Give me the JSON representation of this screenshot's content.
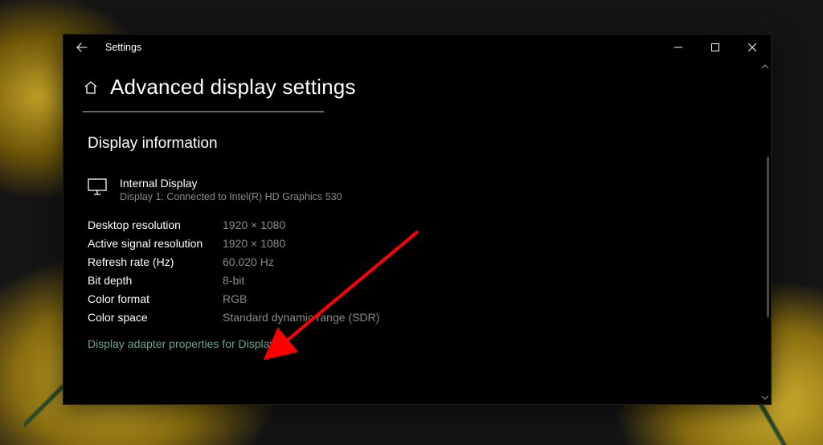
{
  "window": {
    "app_title": "Settings",
    "page_title": "Advanced display settings"
  },
  "section": {
    "heading": "Display information",
    "display_name": "Internal Display",
    "display_sub": "Display 1: Connected to Intel(R) HD Graphics 530",
    "props": {
      "desktop_res": {
        "label": "Desktop resolution",
        "value": "1920 × 1080"
      },
      "signal_res": {
        "label": "Active signal resolution",
        "value": "1920 × 1080"
      },
      "refresh": {
        "label": "Refresh rate (Hz)",
        "value": "60.020 Hz"
      },
      "bit_depth": {
        "label": "Bit depth",
        "value": "8-bit"
      },
      "color_format": {
        "label": "Color format",
        "value": "RGB"
      },
      "color_space": {
        "label": "Color space",
        "value": "Standard dynamic range (SDR)"
      }
    },
    "link": "Display adapter properties for Display 1"
  }
}
